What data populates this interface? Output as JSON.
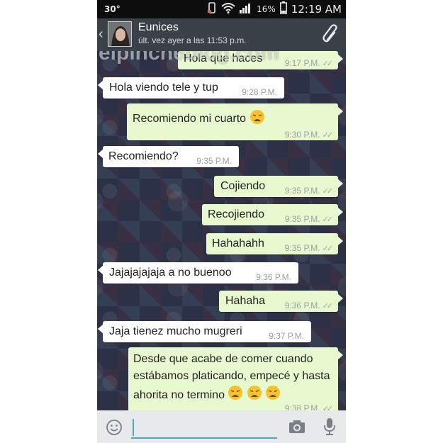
{
  "status_bar": {
    "temperature": "30°",
    "battery": "16%",
    "time": "12:19 AM"
  },
  "header": {
    "contact_name": "Eunices",
    "last_seen": "últ. vez ayer a las 11:53 p.m."
  },
  "watermark": "elpinchebiog.com",
  "messages": [
    {
      "direction": "out",
      "text": "Hola que haces",
      "time": "9:17 P.M."
    },
    {
      "direction": "in",
      "text": "Hola viendo tele y tup",
      "time": "9:28 P.M."
    },
    {
      "direction": "out",
      "text": "Recomiendo mi cuarto",
      "time": "9:30 P.M."
    },
    {
      "direction": "in",
      "text": "Recomiendo?",
      "time": "9:35 P.M."
    },
    {
      "direction": "out",
      "text": "Cojiendo",
      "time": "9:35 P.M."
    },
    {
      "direction": "out",
      "text": "Recojiendo",
      "time": "9:35 P.M."
    },
    {
      "direction": "out",
      "text": "Hahahahh",
      "time": "9:35 P.M."
    },
    {
      "direction": "in",
      "text": "Jajajajajaja a no buenoo",
      "time": "9:36 P.M."
    },
    {
      "direction": "out",
      "text": "Hahaha",
      "time": "9:36 P.M."
    },
    {
      "direction": "in",
      "text": "Jaja tienez mucho mugreri",
      "time": "9:37 P.M."
    },
    {
      "direction": "out",
      "text": "Desde que acabe de comer cuando estábamos platicando, empecé y hasta ahorita no termino",
      "time": "9:38 P.M."
    }
  ],
  "colors": {
    "outgoing_bubble": "#e9f9cf",
    "incoming_bubble": "#ffffff",
    "action_bar": "#3a4148",
    "input_accent": "#4aa8c9"
  }
}
